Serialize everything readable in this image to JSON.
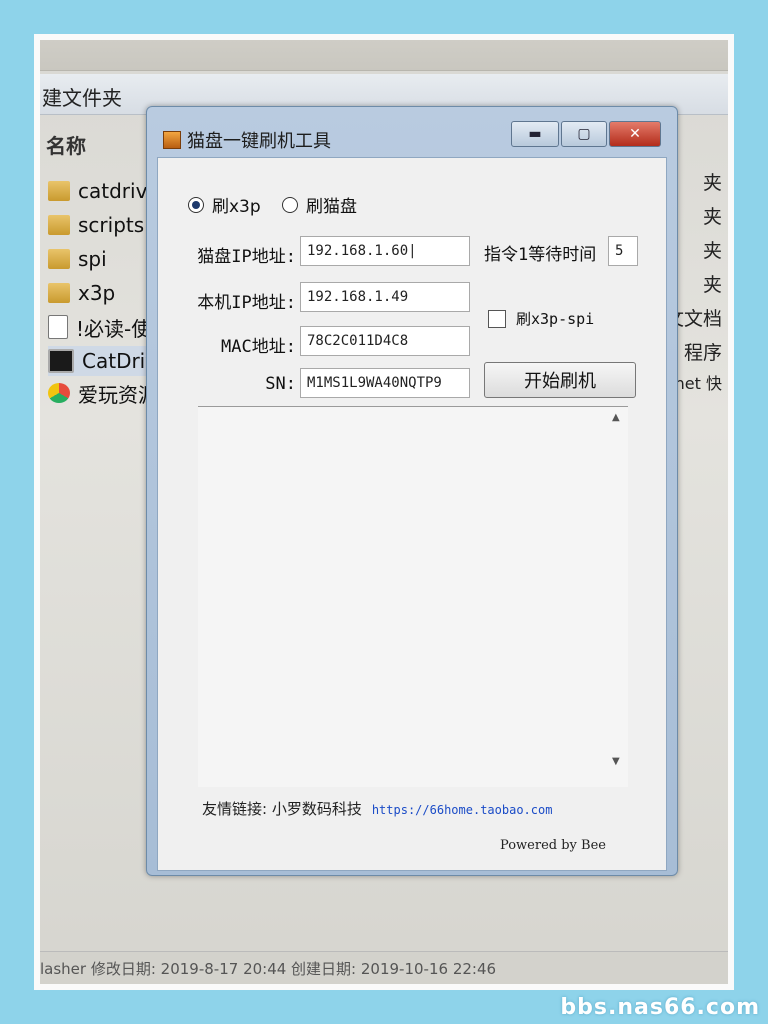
{
  "explorer": {
    "toolbar_label": "建文件夹",
    "column_header": "名称",
    "files": [
      {
        "name": "catdrive",
        "icon": "folder-icon"
      },
      {
        "name": "scripts",
        "icon": "folder-icon"
      },
      {
        "name": "spi",
        "icon": "folder-icon"
      },
      {
        "name": "x3p",
        "icon": "folder-icon"
      },
      {
        "name": "!必读-使",
        "icon": "document-icon"
      },
      {
        "name": "CatDrive",
        "icon": "app-icon"
      },
      {
        "name": "爱玩资源",
        "icon": "chrome-icon"
      }
    ],
    "right_types": [
      "夹",
      "夹",
      "夹",
      "夹",
      "文文档",
      "程序",
      "rnet 快"
    ],
    "status_text": "lasher  修改日期: 2019-8-17 20:44        创建日期: 2019-10-16 22:46"
  },
  "dialog": {
    "title": "猫盘一键刷机工具",
    "radio_x3p": "刷x3p",
    "radio_catdisk": "刷猫盘",
    "catdisk_ip_label": "猫盘IP地址:",
    "catdisk_ip_value": "192.168.1.60|",
    "local_ip_label": "本机IP地址:",
    "local_ip_value": "192.168.1.49",
    "mac_label": "MAC地址:",
    "mac_value": "78C2C011D4C8",
    "sn_label": "SN:",
    "sn_value": "M1MS1L9WA40NQTP9",
    "wait_label": "指令1等待时间",
    "wait_value": "5",
    "checkbox_label": "刷x3p-spi",
    "start_button": "开始刷机",
    "footer_label": "友情链接: 小罗数码科技",
    "footer_link": "https://66home.taobao.com",
    "powered_by": "Powered by Bee"
  },
  "watermark": "bbs.nas66.com"
}
